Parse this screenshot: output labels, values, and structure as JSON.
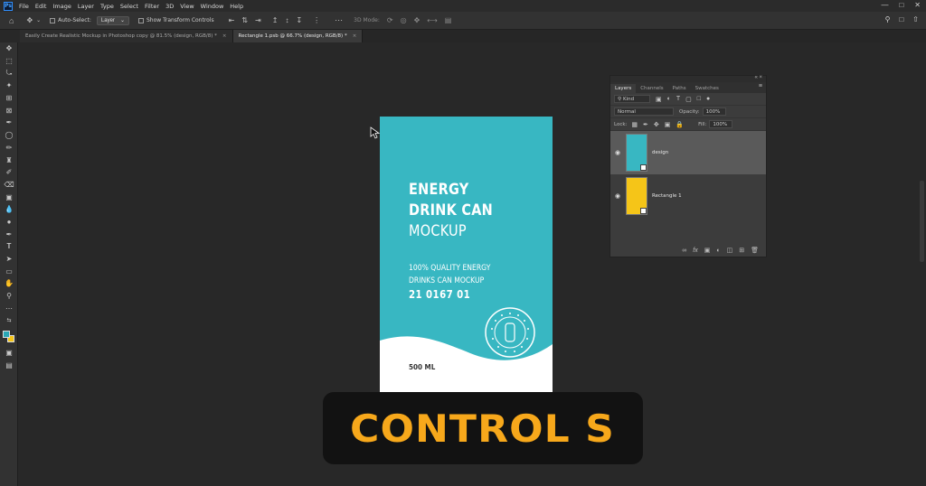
{
  "app": {
    "logo": "Ps"
  },
  "menu": [
    "File",
    "Edit",
    "Image",
    "Layer",
    "Type",
    "Select",
    "Filter",
    "3D",
    "View",
    "Window",
    "Help"
  ],
  "options": {
    "auto_select_label": "Auto-Select:",
    "layer_select": "Layer",
    "transform_label": "Show Transform Controls",
    "mode_3d": "3D Mode:"
  },
  "tabs": [
    {
      "label": "Easily Create Realistic Mockup in Photoshop copy @ 81.5% (design, RGB/8) *",
      "close": "×"
    },
    {
      "label": "Rectangle 1.psb @ 66.7% (design, RGB/8) *",
      "close": "×"
    }
  ],
  "artboard": {
    "title_line1": "ENERGY",
    "title_line2": "DRINK CAN",
    "title_line3": "MOCKUP",
    "sub_line1": "100% QUALITY ENERGY",
    "sub_line2": "DRINKS CAN MOCKUP",
    "code": "21 0167 01",
    "volume": "500 ML",
    "colors": {
      "teal": "#38b7c2",
      "white": "#ffffff"
    }
  },
  "layers_panel": {
    "tabs": [
      "Layers",
      "Channels",
      "Paths",
      "Swatches"
    ],
    "filter_kind": "Kind",
    "blend_mode": "Normal",
    "opacity_label": "Opacity:",
    "opacity_value": "100%",
    "lock_label": "Lock:",
    "fill_label": "Fill:",
    "fill_value": "100%",
    "layers": [
      {
        "name": "design",
        "selected": true,
        "color": "#38b7c2"
      },
      {
        "name": "Rectangle 1",
        "selected": false,
        "color": "#f5c518"
      }
    ]
  },
  "swatches": {
    "foreground": "#2aa7b5",
    "background": "#f5c518"
  },
  "caption": {
    "text": "CONTROL S",
    "color": "#f7a81b"
  }
}
